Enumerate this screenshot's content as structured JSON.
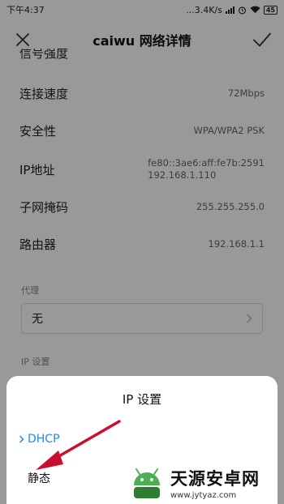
{
  "status_bar": {
    "time": "下午4:37",
    "network_speed": "...3.4K/s",
    "battery": "45"
  },
  "header": {
    "title": "caiwu  网络详情"
  },
  "details": [
    {
      "label": "信号强度",
      "value": ""
    },
    {
      "label": "连接速度",
      "value": "72Mbps"
    },
    {
      "label": "安全性",
      "value": "WPA/WPA2 PSK"
    },
    {
      "label": "IP地址",
      "value": "fe80::3ae6:aff:fe7b:2591\n192.168.1.110"
    },
    {
      "label": "子网掩码",
      "value": "255.255.255.0"
    },
    {
      "label": "路由器",
      "value": "192.168.1.1"
    }
  ],
  "proxy": {
    "section_label": "代理",
    "selected": "无"
  },
  "ip_settings": {
    "section_label": "IP 设置"
  },
  "sheet": {
    "title": "IP  设置",
    "options": [
      {
        "label": "DHCP",
        "selected": true
      },
      {
        "label": "静态",
        "selected": false
      }
    ]
  },
  "colors": {
    "accent": "#1f8ce6",
    "annotation_arrow": "#c8102e",
    "overlay": "rgba(0,0,0,0.40)"
  },
  "watermark": {
    "name": "天源安卓网",
    "url": "www.jytyaz.com"
  }
}
